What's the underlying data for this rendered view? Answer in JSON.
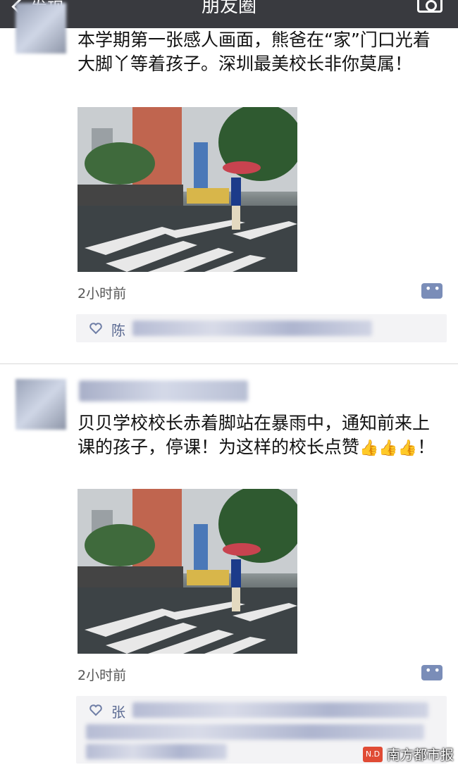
{
  "nav": {
    "back_label": "发现",
    "title": "朋友圈"
  },
  "posts": [
    {
      "text": "本学期第一张感人画面，熊爸在“家”门口光着大脚丫等着孩子。深圳最美校长非你莫属！",
      "time": "2小时前",
      "likes_lead": "陈"
    },
    {
      "text": "贝贝学校校长赤着脚站在暴雨中，通知前来上课的孩子，停课！为这样的校长点赞",
      "thumbs": "👍👍👍",
      "after_thumbs": "！",
      "time": "2小时前",
      "likes_lead": "张"
    }
  ],
  "watermark": {
    "logo": "N.D",
    "text": "南方都市报"
  },
  "colors": {
    "topbar": "#393a3f",
    "link": "#5b6a92",
    "likes_bg": "#f3f3f5"
  }
}
